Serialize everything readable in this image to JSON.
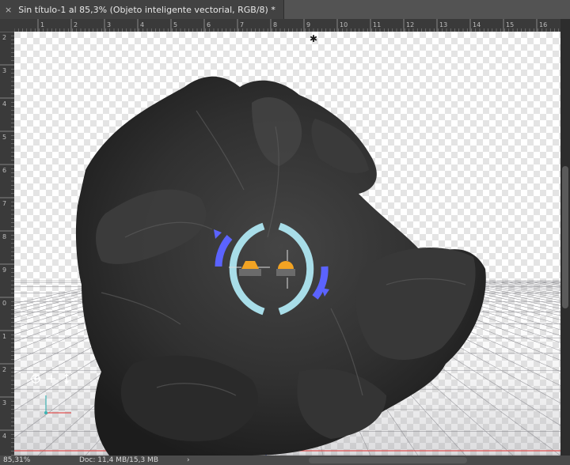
{
  "document_tab": {
    "close_glyph": "×",
    "title": "Sin título-1 al 85,3% (Objeto inteligente vectorial, RGB/8) *"
  },
  "ruler_top": {
    "labels": [
      "1",
      "2",
      "3",
      "4",
      "5",
      "6",
      "7",
      "8",
      "9",
      "10",
      "11",
      "12",
      "13",
      "14",
      "15",
      "16"
    ]
  },
  "ruler_left": {
    "labels": [
      "2",
      "3",
      "4",
      "5",
      "6",
      "7",
      "8",
      "9",
      "0",
      "1",
      "2",
      "3",
      "4"
    ]
  },
  "canvas": {
    "light_marker": "✱",
    "model": "dark-3d-fabric-shape",
    "widget": "3d-rotate-widget"
  },
  "status_bar": {
    "zoom": "85,31%",
    "doc_info": "Doc: 11,4 MB/15,3 MB",
    "arrow": "›"
  },
  "colors": {
    "tab_bar": "#535353",
    "model": "#2f2f2f",
    "widget_ring": "#a8dde8",
    "widget_accent": "#5b63ff",
    "handle_orange": "#f2a323",
    "axis_red": "#e05050"
  }
}
